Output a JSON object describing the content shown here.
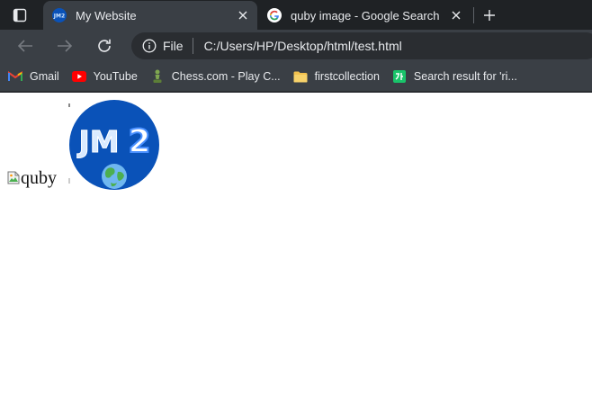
{
  "browser": {
    "tabs": [
      {
        "title": "My Website",
        "favicon": "jm2-icon",
        "active": true
      },
      {
        "title": "quby image - Google Search",
        "favicon": "google-icon",
        "active": false
      }
    ],
    "address": {
      "scheme_label": "File",
      "url": "C:/Users/HP/Desktop/html/test.html"
    },
    "bookmarks": [
      {
        "label": "Gmail",
        "icon": "gmail-icon"
      },
      {
        "label": "YouTube",
        "icon": "youtube-icon"
      },
      {
        "label": "Chess.com - Play C...",
        "icon": "chess-icon"
      },
      {
        "label": "firstcollection",
        "icon": "folder-icon"
      },
      {
        "label": "Search result for 'ri...",
        "icon": "search-result-icon"
      }
    ]
  },
  "page": {
    "broken_image_alt": "quby",
    "logo": {
      "text_jm": "JM",
      "text_2": "2"
    }
  },
  "colors": {
    "tab_strip": "#1f2225",
    "toolbar": "#3a3f45",
    "omnibox": "#2a2d31",
    "logo_bg": "#0a52b8"
  }
}
